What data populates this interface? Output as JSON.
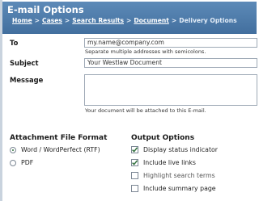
{
  "header": {
    "title": "E-mail Options",
    "breadcrumbs": [
      "Home",
      "Cases",
      "Search Results",
      "Document"
    ],
    "current_page": "Delivery Options",
    "separator": ">"
  },
  "form": {
    "to_label": "To",
    "to_value": "my.name@company.com",
    "to_hint": "Separate multiple addresses with semicolons.",
    "subject_label": "Subject",
    "subject_value": "Your Westlaw Document",
    "message_label": "Message",
    "message_value": "",
    "message_hint": "Your document will be attached to this E-mail."
  },
  "attachment": {
    "title": "Attachment File Format",
    "options": [
      {
        "label": "Word / WordPerfect (RTF)",
        "selected": true
      },
      {
        "label": "PDF",
        "selected": false
      }
    ]
  },
  "output": {
    "title": "Output Options",
    "options": [
      {
        "label": "Display status indicator",
        "checked": true
      },
      {
        "label": "Include live links",
        "checked": true
      },
      {
        "label": "Highlight search terms",
        "checked": false
      },
      {
        "label": "Include summary page",
        "checked": false
      }
    ]
  },
  "colors": {
    "header_bg": "#4a77a6",
    "check_mark": "#2e6e3a"
  }
}
